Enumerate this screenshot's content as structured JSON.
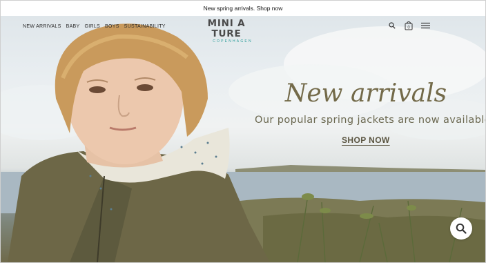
{
  "announcement": {
    "text": "New spring arrivals. Shop now"
  },
  "header": {
    "nav": [
      {
        "label": "NEW ARRIVALS"
      },
      {
        "label": "BABY"
      },
      {
        "label": "GIRLS"
      },
      {
        "label": "BOYS"
      },
      {
        "label": "SUSTAINABILITY"
      }
    ],
    "logo": {
      "main": "MINI A TURE",
      "sub": "COPENHAGEN"
    },
    "icons": {
      "search": "search-icon",
      "cart": "shopping-bag-icon",
      "cart_count": "0",
      "menu": "hamburger-menu-icon"
    }
  },
  "hero": {
    "title": "New arrivals",
    "subtitle": "Our popular spring jackets are now available",
    "cta": "SHOP NOW",
    "image": "boy-in-olive-jacket-by-sea-photo"
  },
  "floating": {
    "search_icon": "search-icon"
  },
  "colors": {
    "hero_text": "#736a49",
    "logo_accent": "#2a9d9a",
    "jacket": "#6f6a4b"
  }
}
